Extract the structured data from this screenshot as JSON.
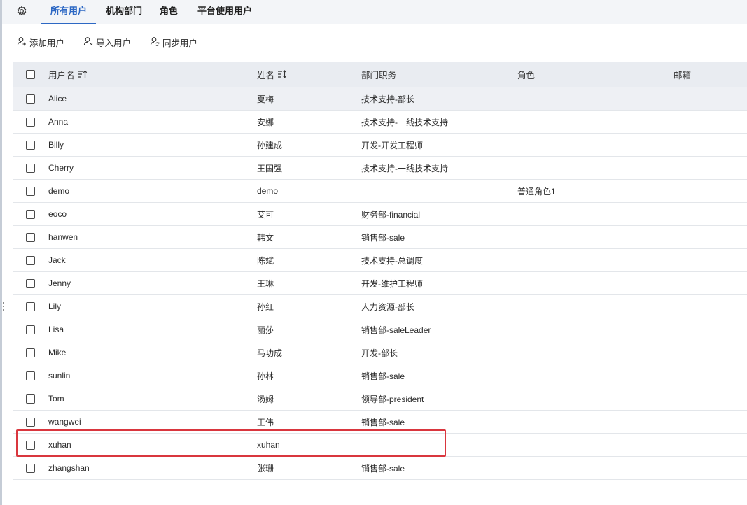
{
  "tabs": [
    {
      "label": "所有用户",
      "active": true
    },
    {
      "label": "机构部门",
      "active": false
    },
    {
      "label": "角色",
      "active": false
    },
    {
      "label": "平台使用用户",
      "active": false
    }
  ],
  "toolbar": {
    "add_label": "添加用户",
    "import_label": "导入用户",
    "sync_label": "同步用户"
  },
  "table": {
    "columns": {
      "username": "用户名",
      "name": "姓名",
      "dept": "部门职务",
      "role": "角色",
      "email": "邮箱"
    },
    "rows": [
      {
        "username": "Alice",
        "name": "夏梅",
        "dept": "技术支持-部长",
        "role": "",
        "email": ""
      },
      {
        "username": "Anna",
        "name": "安娜",
        "dept": "技术支持-一线技术支持",
        "role": "",
        "email": ""
      },
      {
        "username": "Billy",
        "name": "孙建成",
        "dept": "开发-开发工程师",
        "role": "",
        "email": ""
      },
      {
        "username": "Cherry",
        "name": "王国强",
        "dept": "技术支持-一线技术支持",
        "role": "",
        "email": ""
      },
      {
        "username": "demo",
        "name": "demo",
        "dept": "",
        "role": "普通角色1",
        "email": ""
      },
      {
        "username": "eoco",
        "name": "艾可",
        "dept": "财务部-financial",
        "role": "",
        "email": ""
      },
      {
        "username": "hanwen",
        "name": "韩文",
        "dept": "销售部-sale",
        "role": "",
        "email": ""
      },
      {
        "username": "Jack",
        "name": "陈斌",
        "dept": "技术支持-总调度",
        "role": "",
        "email": ""
      },
      {
        "username": "Jenny",
        "name": "王琳",
        "dept": "开发-维护工程师",
        "role": "",
        "email": ""
      },
      {
        "username": "Lily",
        "name": "孙红",
        "dept": "人力资源-部长",
        "role": "",
        "email": ""
      },
      {
        "username": "Lisa",
        "name": "丽莎",
        "dept": "销售部-saleLeader",
        "role": "",
        "email": ""
      },
      {
        "username": "Mike",
        "name": "马功成",
        "dept": "开发-部长",
        "role": "",
        "email": ""
      },
      {
        "username": "sunlin",
        "name": "孙林",
        "dept": "销售部-sale",
        "role": "",
        "email": ""
      },
      {
        "username": "Tom",
        "name": "汤姆",
        "dept": "领导部-president",
        "role": "",
        "email": ""
      },
      {
        "username": "wangwei",
        "name": "王伟",
        "dept": "销售部-sale",
        "role": "",
        "email": ""
      },
      {
        "username": "xuhan",
        "name": "xuhan",
        "dept": "",
        "role": "",
        "email": ""
      },
      {
        "username": "zhangshan",
        "name": "张珊",
        "dept": "销售部-sale",
        "role": "",
        "email": ""
      }
    ]
  },
  "colors": {
    "accent": "#2d68c4",
    "highlight_border": "#d9363e",
    "header_bg": "#e9ecf1"
  },
  "icons": {
    "settings": "gear-icon",
    "add": "add-user-icon",
    "import": "import-user-icon",
    "sync": "sync-user-icon",
    "sort_asc": "sort-asc-icon",
    "sort_both": "sort-icon"
  }
}
